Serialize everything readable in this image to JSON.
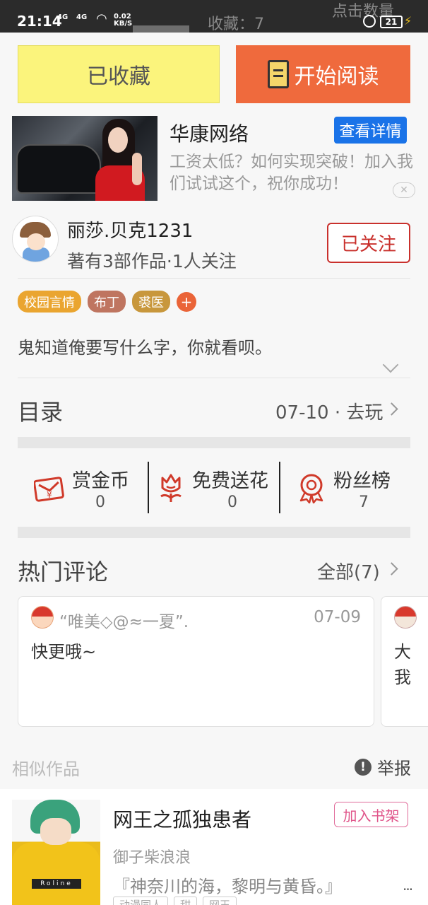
{
  "status_bar": {
    "time": "21:14",
    "signal1": "4G",
    "signal2": "4G",
    "net_speed_value": "0.02",
    "net_speed_unit": "KB/S",
    "battery": "21",
    "background_text_collect": "收藏：7",
    "background_text_other": "点击数量"
  },
  "actions": {
    "collected_label": "已收藏",
    "start_reading_label": "开始阅读",
    "start_reading_icon": "book-icon"
  },
  "ad": {
    "title": "华康网络",
    "detail_button": "查看详情",
    "description": "工资太低？如何实现突破！加入我们试试这个，祝你成功！"
  },
  "author": {
    "name": "丽莎.贝克1231",
    "meta": "著有3部作品·1人关注",
    "follow_label": "已关注"
  },
  "tags": [
    {
      "label": "校园言情",
      "color": "#eaa530"
    },
    {
      "label": "布丁",
      "color": "#bf7560"
    },
    {
      "label": "裘医",
      "color": "#c8973c"
    }
  ],
  "tag_add_label": "+",
  "description": "鬼知道俺要写什么字，你就看呗。",
  "catalog": {
    "label": "目录",
    "latest": "07-10 · 去玩"
  },
  "stats": [
    {
      "label": "赏金币",
      "value": "0",
      "icon": "red-envelope-icon"
    },
    {
      "label": "免费送花",
      "value": "0",
      "icon": "flower-icon"
    },
    {
      "label": "粉丝榜",
      "value": "7",
      "icon": "medal-icon"
    }
  ],
  "hot_comments": {
    "label": "热门评论",
    "all_label": "全部(7)",
    "items": [
      {
        "user": "“唯美◇@≈一夏”.",
        "date": "07-09",
        "text": "快更哦~"
      },
      {
        "user": "",
        "date": "",
        "text": "大\n我"
      }
    ]
  },
  "similar": {
    "label": "相似作品",
    "report_label": "举报",
    "book": {
      "title": "网王之孤独患者",
      "add_shelf_label": "加入书架",
      "author": "御子柴浪浪",
      "quote": "『神奈川的海，黎明与黄昏。』",
      "more": "...",
      "tags": [
        "动漫同人",
        "甜",
        "网王"
      ],
      "cover_text": "Roline"
    }
  },
  "colors": {
    "accent_orange": "#ef6a3d",
    "collected_yellow": "#fbf47c",
    "follow_red": "#c9302c",
    "ad_blue": "#1a73e8"
  }
}
